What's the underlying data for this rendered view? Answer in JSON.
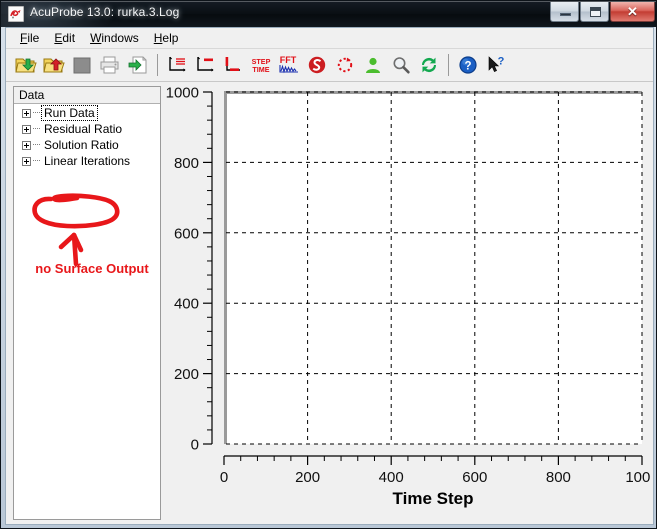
{
  "window": {
    "title": "AcuProbe 13.0:   rurka.3.Log",
    "icon": "acuprobe-app-icon",
    "controls": {
      "minimize": "minimize-button",
      "maximize": "restore-button",
      "close": "close-button",
      "close_glyph": "✕"
    }
  },
  "menubar": {
    "items": [
      {
        "label": "File",
        "accel": "F"
      },
      {
        "label": "Edit",
        "accel": "E"
      },
      {
        "label": "Windows",
        "accel": "W"
      },
      {
        "label": "Help",
        "accel": "H"
      }
    ]
  },
  "toolbar": {
    "buttons": [
      {
        "name": "open-folder-icon",
        "tooltip": "Open"
      },
      {
        "name": "save-folder-icon",
        "tooltip": "Save"
      },
      {
        "name": "stop-icon",
        "tooltip": "Stop"
      },
      {
        "name": "print-icon",
        "tooltip": "Print"
      },
      {
        "name": "export-icon",
        "tooltip": "Export"
      },
      {
        "name": "plot-legend-icon",
        "tooltip": "Plot Legend"
      },
      {
        "name": "plot-line-icon",
        "tooltip": "Plot Line"
      },
      {
        "name": "plot-bar-icon",
        "tooltip": "Plot Bar"
      },
      {
        "name": "step-time-icon",
        "tooltip": "Step / Time"
      },
      {
        "name": "fft-icon",
        "tooltip": "FFT"
      },
      {
        "name": "acusolve-logo-icon",
        "tooltip": "AcuSolve"
      },
      {
        "name": "refresh-dashed-icon",
        "tooltip": "Refresh"
      },
      {
        "name": "user-icon",
        "tooltip": "User"
      },
      {
        "name": "zoom-icon",
        "tooltip": "Zoom"
      },
      {
        "name": "sync-icon",
        "tooltip": "Sync"
      },
      {
        "name": "help-icon",
        "tooltip": "Help"
      },
      {
        "name": "context-help-icon",
        "tooltip": "Context Help"
      }
    ]
  },
  "tree": {
    "header": "Data",
    "items": [
      {
        "label": "Run Data",
        "expanded": false,
        "focused": true
      },
      {
        "label": "Residual Ratio",
        "expanded": false,
        "focused": false
      },
      {
        "label": "Solution Ratio",
        "expanded": false,
        "focused": false
      },
      {
        "label": "Linear Iterations",
        "expanded": false,
        "focused": false
      }
    ]
  },
  "annotation": {
    "text": "no Surface Output",
    "color": "#e8171a",
    "shapes": "hand-drawn ellipse with upward arrow"
  },
  "chart_data": {
    "type": "line",
    "title": "",
    "xlabel": "Time Step",
    "ylabel": "",
    "xlim": [
      0,
      1000
    ],
    "ylim": [
      0,
      1000
    ],
    "xticks": [
      0,
      200,
      400,
      600,
      800,
      1000
    ],
    "yticks": [
      0,
      200,
      400,
      600,
      800,
      1000
    ],
    "xticklabels": [
      "0",
      "200",
      "400",
      "600",
      "800",
      "1000"
    ],
    "yticklabels": [
      "0",
      "200",
      "400",
      "600",
      "800",
      "1000"
    ],
    "minor_ticks_per_major": 4,
    "grid": true,
    "grid_style": "dashed",
    "grid_color": "#000000",
    "plot_background": "#ffffff",
    "legend": null,
    "series": [],
    "note": "Empty plot — no data series rendered"
  }
}
